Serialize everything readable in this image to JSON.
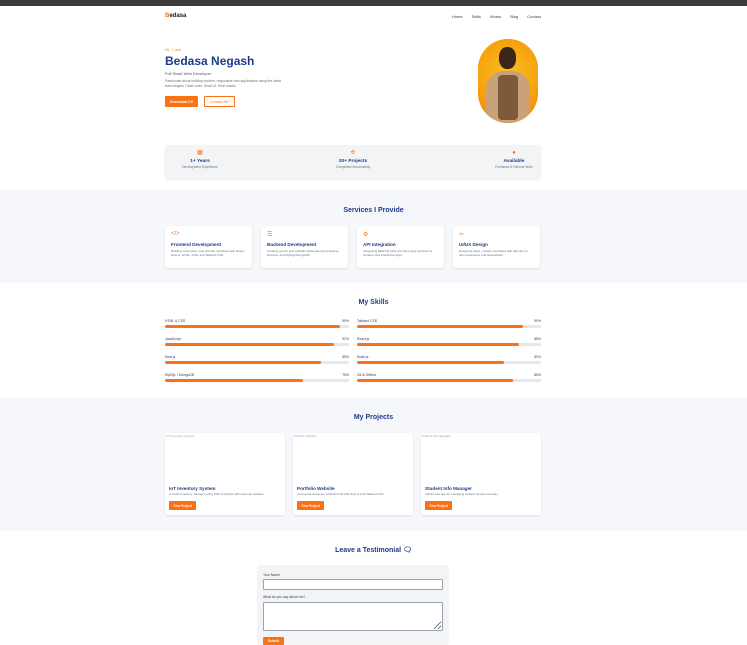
{
  "nav": {
    "logo_first": "B",
    "logo_rest": "edasa",
    "links": [
      "Home",
      "Skills",
      "Works",
      "Blog",
      "Contact"
    ]
  },
  "hero": {
    "kicker": "Hi, I am",
    "name": "Bedasa Negash",
    "role": "Full Stack Web Developer",
    "description": "Passionate about building modern, responsive web applications using the latest technologies. Clean code. Great UI. Real results.",
    "download_label": "Download CV",
    "contact_label": "Contact Me"
  },
  "stats": [
    {
      "icon": "calendar-icon",
      "value": "1+ Years",
      "label": "Development Experience"
    },
    {
      "icon": "projects-icon",
      "value": "20+ Projects",
      "label": "Completed Successfully"
    },
    {
      "icon": "clock-icon",
      "value": "Available",
      "label": "Freelance & Remote Work"
    }
  ],
  "services": {
    "title": "Services I Provide",
    "items": [
      {
        "icon": "code-icon",
        "title": "Frontend Development",
        "desc": "Building responsive, user-friendly interfaces with React, Next.js, HTML, CSS, and Tailwind CSS."
      },
      {
        "icon": "server-icon",
        "title": "Backend Development",
        "desc": "Creating secure and scalable backends using Node.js, Express, and MySQL/MongoDB."
      },
      {
        "icon": "api-icon",
        "title": "API Integration",
        "desc": "Integrating RESTful APIs and third-party services for dynamic and interactive apps."
      },
      {
        "icon": "design-icon",
        "title": "UI/UX Design",
        "desc": "Designing clean, modern interfaces with attention to user experience and accessibility."
      }
    ]
  },
  "skills": {
    "title": "My Skills",
    "items": [
      {
        "name": "HTML & CSS",
        "pct": "95%",
        "value": 95
      },
      {
        "name": "Tailwind CSS",
        "pct": "90%",
        "value": 90
      },
      {
        "name": "JavaScript",
        "pct": "92%",
        "value": 92
      },
      {
        "name": "React.js",
        "pct": "88%",
        "value": 88
      },
      {
        "name": "Next.js",
        "pct": "85%",
        "value": 85
      },
      {
        "name": "Node.js",
        "pct": "80%",
        "value": 80
      },
      {
        "name": "MySQL / MongoDB",
        "pct": "75%",
        "value": 75
      },
      {
        "name": "Git & GitHub",
        "pct": "85%",
        "value": 85
      }
    ]
  },
  "projects": {
    "title": "My Projects",
    "view_label": "View Project",
    "items": [
      {
        "alt": "IoT Inventory System",
        "title": "IoT Inventory System",
        "desc": "A smart inventory manager using PHP & MySQL with real-time updates."
      },
      {
        "alt": "Portfolio Website",
        "title": "Portfolio Website",
        "desc": "A personal developer portfolio built with Next.js and Tailwind CSS."
      },
      {
        "alt": "Student Info Manager",
        "title": "Student Info Manager",
        "desc": "CRUD web app for managing student records securely."
      }
    ]
  },
  "testimonial": {
    "title": "Leave a Testimonial",
    "name_label": "Your Name",
    "message_label": "What do you say about me?",
    "submit_label": "Submit"
  },
  "colors": {
    "accent": "#f97316",
    "heading": "#1e3a8a"
  }
}
